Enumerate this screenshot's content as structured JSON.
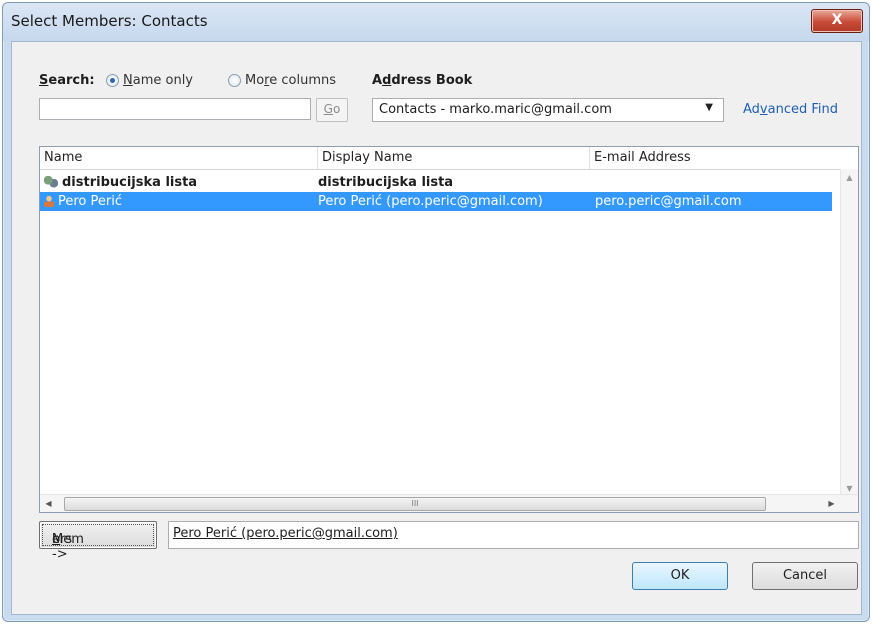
{
  "window": {
    "title": "Select Members: Contacts",
    "close_glyph": "X"
  },
  "search": {
    "label_pre": "",
    "label_u": "S",
    "label_post": "earch:",
    "name_only": {
      "u": "N",
      "rest": "ame only",
      "checked": true
    },
    "more_columns": {
      "pre": "Mo",
      "u": "r",
      "post": "e columns",
      "checked": false
    },
    "input_value": "",
    "go": {
      "u": "G",
      "rest": "o"
    }
  },
  "address_book": {
    "label_pre": "A",
    "label_u": "d",
    "label_post": "dress Book",
    "selected": "Contacts - marko.maric@gmail.com",
    "advanced_find": {
      "pre": "Ad",
      "u": "v",
      "post": "anced Find"
    }
  },
  "list": {
    "columns": [
      "Name",
      "Display Name",
      "E-mail Address"
    ],
    "rows": [
      {
        "name": "distribucijska lista",
        "display": "distribucijska lista",
        "email": "",
        "icon": "distribution-list-icon",
        "bold": true,
        "selected": false
      },
      {
        "name": "Pero Perić",
        "display": "Pero Perić (pero.peric@gmail.com)",
        "email": "pero.peric@gmail.com",
        "icon": "contact-person-icon",
        "bold": false,
        "selected": true
      }
    ],
    "hscroll_grip": "III"
  },
  "members": {
    "button_pre": "Mem",
    "button_u": "b",
    "button_post": "ers ->",
    "value": "Pero Perić (pero.peric@gmail.com)"
  },
  "buttons": {
    "ok": "OK",
    "cancel": "Cancel"
  },
  "colors": {
    "selection": "#3399ff",
    "link": "#1d5fb6",
    "close": "#c84a36"
  }
}
